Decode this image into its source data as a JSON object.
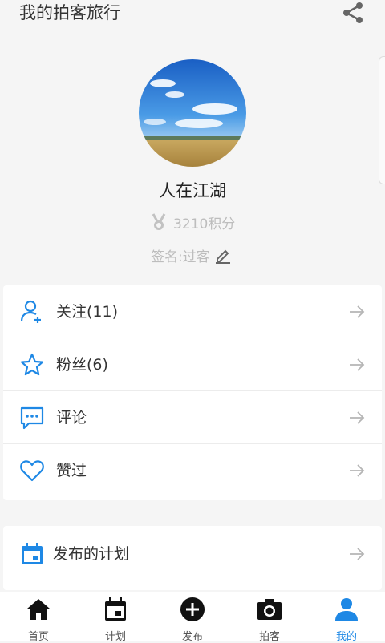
{
  "header": {
    "title": "我的拍客旅行",
    "share_icon": "share-icon"
  },
  "profile": {
    "nickname": "人在江湖",
    "points": "3210积分",
    "signature": "签名:过客"
  },
  "menu": [
    {
      "label": "关注(11)",
      "icon": "user-add-icon"
    },
    {
      "label": "粉丝(6)",
      "icon": "star-icon"
    },
    {
      "label": "评论",
      "icon": "comment-icon"
    },
    {
      "label": "赞过",
      "icon": "heart-icon"
    }
  ],
  "menu2": [
    {
      "label": "发布的计划",
      "icon": "calendar-icon"
    }
  ],
  "nav": [
    {
      "label": "首页",
      "icon": "home-icon"
    },
    {
      "label": "计划",
      "icon": "calendar-icon"
    },
    {
      "label": "发布",
      "icon": "add-circle-icon"
    },
    {
      "label": "拍客",
      "icon": "camera-icon"
    },
    {
      "label": "我的",
      "icon": "person-icon",
      "active": true
    }
  ],
  "colors": {
    "accent": "#1e88e5",
    "muted": "#bdbdbd"
  }
}
